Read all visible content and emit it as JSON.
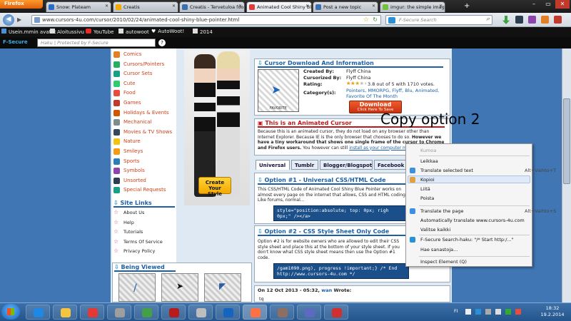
{
  "browser": {
    "app_button": "Firefox",
    "tabs": [
      {
        "label": "Snow: Plateam",
        "color": "#2a6bc4"
      },
      {
        "label": "Creatis",
        "color": "#f2a900"
      },
      {
        "label": "Creatis - Tervetuloa foor...",
        "color": "#3a6fb0"
      },
      {
        "label": "Animated Cool Shiny Blue...",
        "color": "#e23a3a"
      },
      {
        "label": "Post a new topic",
        "color": "#3a6fb0"
      },
      {
        "label": "imgur: the simple image...",
        "color": "#74c043"
      }
    ],
    "new_tab": "+",
    "window": {
      "minimize": "–",
      "maximize": "▭",
      "close": "✕"
    },
    "url": "www.cursors-4u.com/cursor/2010/02/24/animated-cool-shiny-blue-pointer.html",
    "search_placeholder": "F-Secure Search",
    "bookmarks": [
      "Usein.mmin avatut",
      "Aloitussivu",
      "YouTube",
      "autowoot",
      "AutoWoot!",
      "2014"
    ],
    "fsecure_label": "F-Secure",
    "fsecure_placeholder": "Haku | Protected by F-Secure",
    "fsecure_help": "?"
  },
  "left": {
    "categories": [
      {
        "label": "Comics",
        "color": "#e67e22"
      },
      {
        "label": "Cursors/Pointers",
        "color": "#27ae60"
      },
      {
        "label": "Cursor Sets",
        "color": "#16a085"
      },
      {
        "label": "Cute",
        "color": "#2ecc71"
      },
      {
        "label": "Food",
        "color": "#e74c3c"
      },
      {
        "label": "Games",
        "color": "#c0392b"
      },
      {
        "label": "Holidays & Events",
        "color": "#d35400"
      },
      {
        "label": "Mechanical",
        "color": "#7f8c8d"
      },
      {
        "label": "Movies & TV Shows",
        "color": "#34495e"
      },
      {
        "label": "Nature",
        "color": "#f1c40f"
      },
      {
        "label": "Smileys",
        "color": "#f39c12"
      },
      {
        "label": "Sports",
        "color": "#2980b9"
      },
      {
        "label": "Symbols",
        "color": "#8e44ad"
      },
      {
        "label": "Unsorted",
        "color": "#2c3e50"
      },
      {
        "label": "Special Requests",
        "color": "#16a085"
      }
    ],
    "site_links_title": "Site Links",
    "site_links": [
      "About Us",
      "Help",
      "Tutorials",
      "Terms Of Service",
      "Privacy Policy"
    ],
    "being_viewed_title": "Being Viewed"
  },
  "banner": {
    "button": "Create Your Style"
  },
  "cursor_info": {
    "title": "Cursor Download And Information",
    "thumb_caption": "FAVORITE",
    "created_by_label": "Created By:",
    "created_by": "Flyff China",
    "cursorized_label": "Cursorized By:",
    "cursorized": "Flyff China",
    "rating_label": "Rating:",
    "rating_text": "3.8 out of 5 with 1710 votes.",
    "rating_value": 3.8,
    "category_label": "Category(s):",
    "categories": "Pointers, MMORPG, Flyff, Blu, Animated, Favorite Of The Month",
    "download_main": "Download",
    "download_sub": "Click Here To Save"
  },
  "animated": {
    "title": "This is an Animated Cursor",
    "body1": "Because this is an animated cursor, they do not load on any browser other than Internet Explorer. Because IE is the only browser that chooses to do so. ",
    "body_bold": "However we have a tiny workaround that shows one single frame of the cursor to Chrome and Firefox users.",
    "body2": " You however can still ",
    "body_link": "install as your computer mouse."
  },
  "code_tabs": [
    "Universal",
    "Tumblr",
    "Blogger/Blogspot",
    "Facebook"
  ],
  "option1": {
    "title": "Option #1 - Universal CSS/HTML Code",
    "desc": "This CSS/HTML Code of Animated Cool Shiny Blue Pointer works on almost every page on the internet that allows, CSS and HTML coding. Like forums, normal...",
    "code": "style=\"position:absolute; top: 0px; righ\n0px;\" /></a>"
  },
  "option2": {
    "title": "Option #2 - CSS Style Sheet Only Code",
    "desc": "Option #2 is for website owners who are allowed to edit their CSS style sheet and place this at the bottom of your style sheet. If you don't know what CSS style sheet means then use the Option #1 code.",
    "code": "/gam1090.png), progress !important;} /* End\nhttp://www.cursors-4u.com */"
  },
  "comment": {
    "header_prefix": "On 12 Oct 2013 - 05:32, ",
    "author": "wan",
    "header_suffix": " Wrote:",
    "text": "tq"
  },
  "overlay_text": "Copy option 2",
  "context_menu": [
    {
      "label": "Kumoa",
      "disabled": true,
      "shortcut": ""
    },
    {
      "label": "Leikkaa",
      "disabled": false,
      "shortcut": ""
    },
    {
      "label": "Translate selected text",
      "disabled": false,
      "shortcut": "Alt+Vaihto+T"
    },
    {
      "label": "Kopioi",
      "disabled": false,
      "shortcut": ""
    },
    {
      "label": "Liitä",
      "disabled": false,
      "shortcut": ""
    },
    {
      "label": "Poista",
      "disabled": false,
      "shortcut": ""
    },
    {
      "label": "Translate the page",
      "disabled": false,
      "shortcut": "Alt+Vaihto+S"
    },
    {
      "label": "Automatically translate www.cursors-4u.com",
      "disabled": false,
      "shortcut": ""
    },
    {
      "label": "Valitse kaikki",
      "disabled": false,
      "shortcut": ""
    },
    {
      "label": "F-Secure Search-haku: \"/* Start http:/...\"",
      "disabled": false,
      "shortcut": ""
    },
    {
      "label": "Hae sanastoja...",
      "disabled": false,
      "shortcut": ""
    },
    {
      "label": "Inspect Element (Q)",
      "disabled": false,
      "shortcut": ""
    }
  ],
  "taskbar": {
    "language": "FI",
    "time": "18:32",
    "date": "19.2.2014"
  }
}
